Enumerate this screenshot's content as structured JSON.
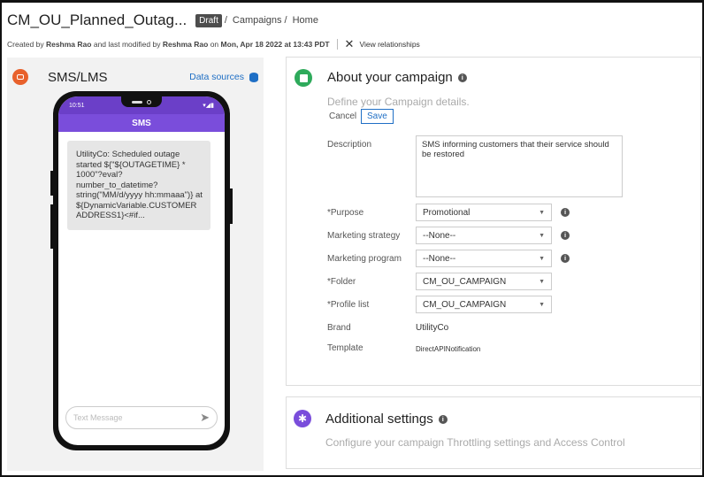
{
  "header": {
    "title": "CM_OU_Planned_Outag...",
    "status_badge": "Draft",
    "breadcrumbs": [
      "Campaigns",
      "Home"
    ],
    "created_by_prefix": "Created by",
    "created_by": "Reshma Rao",
    "modified_prefix": "and last modified by",
    "modified_by": "Reshma Rao",
    "modified_on_prefix": "on",
    "modified_on": "Mon, Apr 18 2022 at 13:43 PDT",
    "view_relationships": "View relationships"
  },
  "left_panel": {
    "title": "SMS/LMS",
    "data_sources_label": "Data sources",
    "icons": {
      "channel": "sms-icon",
      "data_sources": "database-icon"
    },
    "phone": {
      "time": "10:51",
      "status_icons": "▾◢▮",
      "app_title": "SMS",
      "message": "UtilityCo: Scheduled outage started ${\"${OUTAGETIME} * 1000\"?eval?number_to_datetime?string(\"MM/d/yyyy hh:mmaaa\")} at ${DynamicVariable.CUSTOMER ADDRESS1}<#if...",
      "compose_placeholder": "Text Message",
      "send_icon": "send-icon"
    }
  },
  "about": {
    "title": "About your campaign",
    "subtitle": "Define your Campaign details.",
    "cancel_label": "Cancel",
    "save_label": "Save",
    "fields": {
      "description": {
        "label": "Description",
        "value": "SMS informing customers that their service should be restored"
      },
      "purpose": {
        "label": "*Purpose",
        "value": "Promotional"
      },
      "marketing_strategy": {
        "label": "Marketing strategy",
        "value": "--None--"
      },
      "marketing_program": {
        "label": "Marketing program",
        "value": "--None--"
      },
      "folder": {
        "label": "*Folder",
        "value": "CM_OU_CAMPAIGN"
      },
      "profile_list": {
        "label": "*Profile list",
        "value": "CM_OU_CAMPAIGN"
      },
      "brand": {
        "label": "Brand",
        "value": "UtilityCo"
      },
      "template": {
        "label": "Template",
        "value": "DirectAPINotification"
      }
    }
  },
  "additional": {
    "title": "Additional settings",
    "subtitle": "Configure your campaign Throttling settings and Access Control"
  },
  "colors": {
    "sms_accent": "#e8612c",
    "phone_purple": "#7a4ddb",
    "section_green": "#2eaa5b",
    "link_blue": "#1f6fc5"
  }
}
